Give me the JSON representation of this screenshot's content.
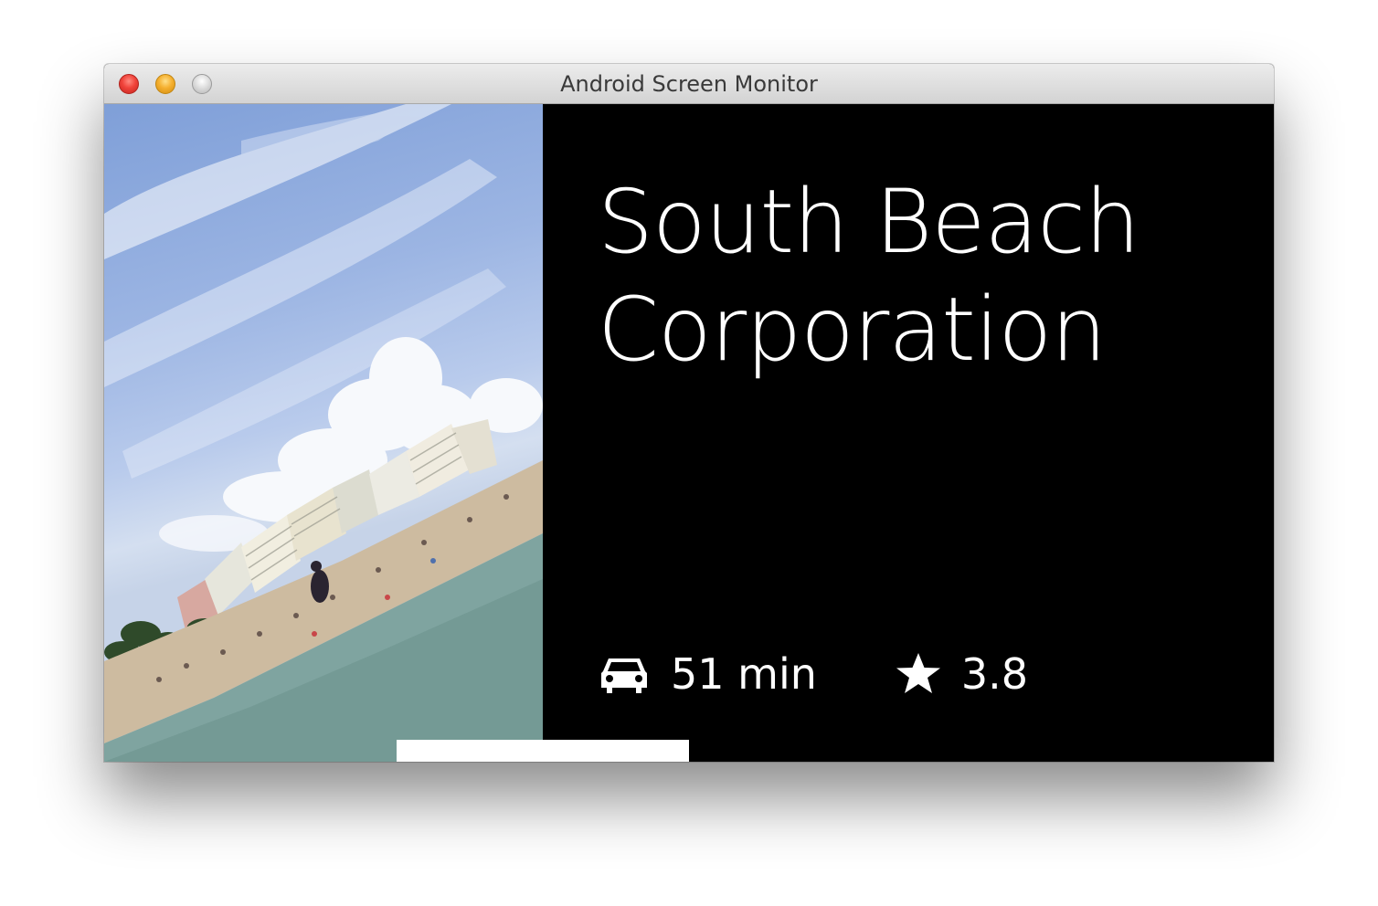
{
  "window": {
    "title": "Android Screen Monitor"
  },
  "card": {
    "name_line1": "South Beach",
    "name_line2": "Corporation",
    "travel_time": "51 min",
    "travel_icon": "car-icon",
    "rating": "3.8",
    "rating_icon": "star-icon",
    "photo_subject": "beach photo"
  },
  "colors": {
    "background": "#000000",
    "text": "#ffffff",
    "close": "#f0433a",
    "minimize": "#f5b030",
    "zoom": "#c8c8c8"
  }
}
